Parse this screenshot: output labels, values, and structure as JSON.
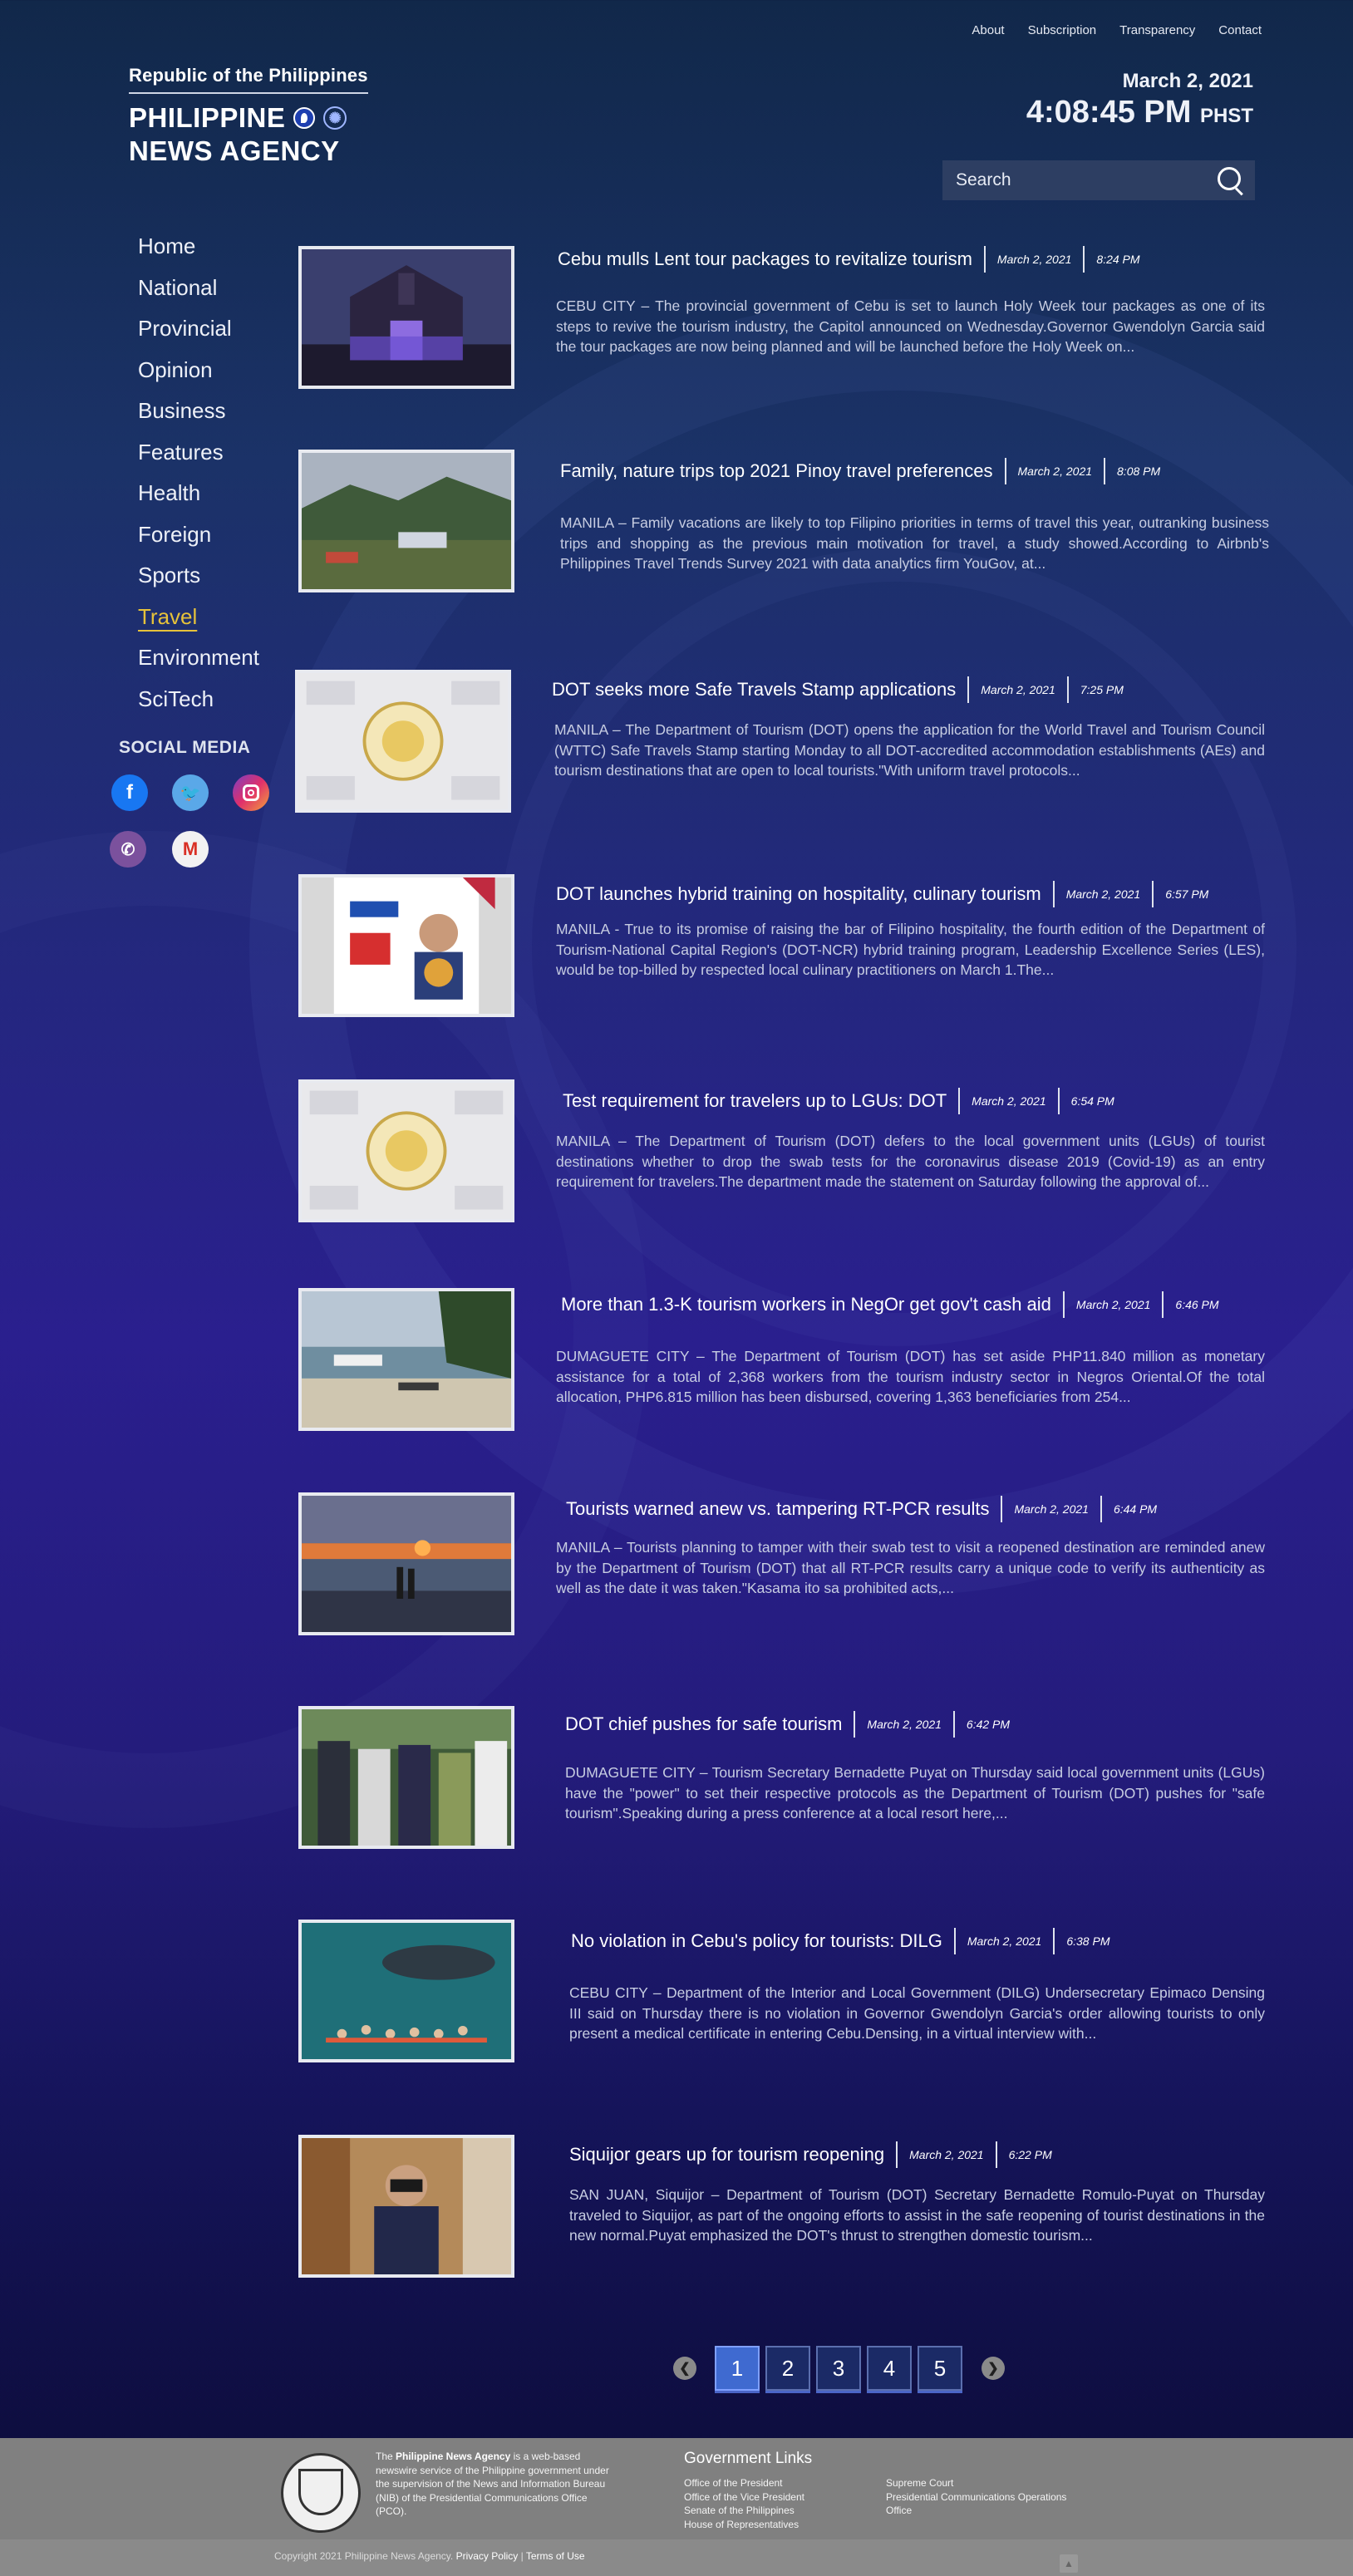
{
  "top_links": [
    "About",
    "Subscription",
    "Transparency",
    "Contact"
  ],
  "logo": {
    "republic": "Republic of the Philippines",
    "line1": "PHILIPPINE",
    "line2": "NEWS AGENCY"
  },
  "datetime": {
    "date": "March 2, 2021",
    "time": "4:08:45 PM",
    "tz": "PHST"
  },
  "search": {
    "placeholder": "Search"
  },
  "nav": [
    "Home",
    "National",
    "Provincial",
    "Opinion",
    "Business",
    "Features",
    "Health",
    "Foreign",
    "Sports",
    "Travel",
    "Environment",
    "SciTech"
  ],
  "nav_active": "Travel",
  "social": {
    "title": "SOCIAL MEDIA"
  },
  "articles": [
    {
      "title": "Cebu mulls Lent tour packages to revitalize tourism",
      "date": "March 2, 2021",
      "time": "8:24 PM",
      "excerpt": "CEBU CITY – The provincial government of Cebu is set to launch Holy Week tour packages as one of its steps to revive the tourism industry, the Capitol announced on Wednesday.Governor Gwendolyn Garcia said the tour packages are now being planned and will be launched before the Holy Week on..."
    },
    {
      "title": "Family, nature trips top 2021 Pinoy travel preferences",
      "date": "March 2, 2021",
      "time": "8:08 PM",
      "excerpt": "MANILA – Family vacations are likely to top Filipino priorities in terms of travel this year, outranking business trips and shopping as the previous main motivation for travel, a study showed.According to Airbnb's Philippines Travel Trends Survey 2021 with data analytics firm YouGov, at..."
    },
    {
      "title": "DOT seeks more Safe Travels Stamp applications",
      "date": "March 2, 2021",
      "time": "7:25 PM",
      "excerpt": "MANILA – The Department of Tourism (DOT) opens the application for the World Travel and Tourism Council (WTTC) Safe Travels Stamp starting Monday to all DOT-accredited accommodation establishments (AEs) and tourism destinations that are open to local tourists.\"With uniform travel protocols..."
    },
    {
      "title": "DOT launches hybrid training on hospitality, culinary tourism",
      "date": "March 2, 2021",
      "time": "6:57 PM",
      "excerpt": "MANILA - True to its promise of raising the bar of Filipino hospitality, the fourth edition of the Department of Tourism-National Capital Region's (DOT-NCR) hybrid training program, Leadership Excellence Series (LES), would be top-billed by respected local culinary practitioners on March 1.The..."
    },
    {
      "title": "Test requirement for travelers up to LGUs: DOT",
      "date": "March 2, 2021",
      "time": "6:54 PM",
      "excerpt": "MANILA – The Department of Tourism (DOT) defers to the local government units (LGUs) of tourist destinations whether to drop the swab tests for the coronavirus disease 2019 (Covid-19) as an entry requirement for travelers.The department made the statement on Saturday following the approval of..."
    },
    {
      "title": "More than 1.3-K tourism workers in NegOr get gov't cash aid",
      "date": "March 2, 2021",
      "time": "6:46 PM",
      "excerpt": "DUMAGUETE CITY – The Department of Tourism (DOT) has set aside PHP11.840 million as monetary assistance for a total of 2,368 workers from the tourism industry sector in Negros Oriental.Of the total allocation, PHP6.815 million has been disbursed, covering 1,363 beneficiaries from 254..."
    },
    {
      "title": "Tourists warned anew vs. tampering RT-PCR results",
      "date": "March 2, 2021",
      "time": "6:44 PM",
      "excerpt": "MANILA – Tourists planning to tamper with their swab test to visit a reopened destination are reminded anew by the Department of Tourism (DOT) that all RT-PCR results carry a unique code to verify its authenticity as well as the date it was taken.\"Kasama ito sa prohibited acts,..."
    },
    {
      "title": "DOT chief pushes for safe tourism",
      "date": "March 2, 2021",
      "time": "6:42 PM",
      "excerpt": "DUMAGUETE CITY – Tourism Secretary Bernadette Puyat on Thursday said local government units (LGUs) have the \"power\" to set their respective protocols as the Department of Tourism (DOT) pushes for \"safe tourism\".Speaking during a press conference at a local resort here,..."
    },
    {
      "title": "No violation in Cebu's policy for tourists: DILG",
      "date": "March 2, 2021",
      "time": "6:38 PM",
      "excerpt": "CEBU CITY – Department of the Interior and Local Government (DILG) Undersecretary Epimaco Densing III said on Thursday there is no violation in Governor Gwendolyn Garcia's order allowing tourists to only present a medical certificate in entering Cebu.Densing, in a virtual interview with..."
    },
    {
      "title": "Siquijor gears up for tourism reopening",
      "date": "March 2, 2021",
      "time": "6:22 PM",
      "excerpt": "SAN JUAN, Siquijor – Department of Tourism (DOT) Secretary Bernadette Romulo-Puyat on Thursday traveled to Siquijor, as part of the ongoing efforts to assist in the safe reopening of tourist destinations in the new normal.Puyat emphasized the DOT's thrust to strengthen domestic tourism..."
    }
  ],
  "pagination": {
    "pages": [
      "1",
      "2",
      "3",
      "4",
      "5"
    ],
    "current": "1"
  },
  "footer": {
    "desc_pre": "The ",
    "desc_bold": "Philippine News Agency",
    "desc_post": " is a web-based newswire service of the Philippine government under the supervision of the News and Information Bureau (NIB) of the Presidential Communications Office (PCO).",
    "gov_links_title": "Government Links",
    "gov_links_col1": [
      "Office of the President",
      "Office of the Vice President",
      "Senate of the Philippines",
      "House of Representatives"
    ],
    "gov_links_col2": [
      "Supreme Court",
      "Presidential Communications Operations",
      "Office"
    ],
    "copyright": "Copyright 2021 Philippine News Agency.",
    "privacy": "Privacy Policy",
    "sep": "|",
    "terms": "Terms of Use"
  }
}
